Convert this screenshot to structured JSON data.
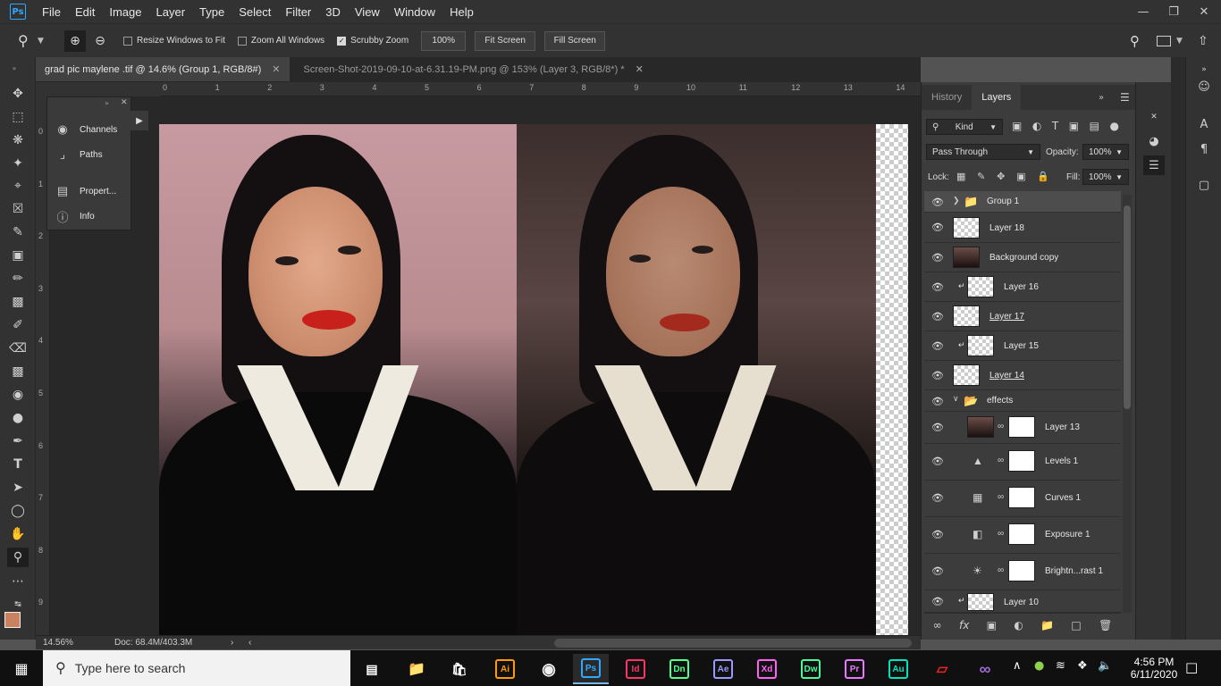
{
  "app": {
    "logo": "Ps",
    "menu": [
      "File",
      "Edit",
      "Image",
      "Layer",
      "Type",
      "Select",
      "Filter",
      "3D",
      "View",
      "Window",
      "Help"
    ],
    "window_controls": [
      "minimize",
      "restore",
      "close"
    ]
  },
  "options_bar": {
    "resize_windows_label": "Resize Windows to Fit",
    "resize_windows_checked": false,
    "zoom_all_label": "Zoom All Windows",
    "zoom_all_checked": false,
    "scrubby_label": "Scrubby Zoom",
    "scrubby_checked": true,
    "zoom_value": "100%",
    "fit_screen": "Fit Screen",
    "fill_screen": "Fill Screen"
  },
  "tabs": [
    {
      "label": "grad pic maylene .tif @ 14.6% (Group 1, RGB/8#)",
      "active": true
    },
    {
      "label": "Screen-Shot-2019-09-10-at-6.31.19-PM.png @ 153% (Layer 3, RGB/8*) *",
      "active": false
    }
  ],
  "ruler_top": [
    "0",
    "1",
    "2",
    "3",
    "4",
    "5",
    "6",
    "7",
    "8",
    "9",
    "10",
    "11",
    "12",
    "13",
    "14"
  ],
  "ruler_left": [
    "0",
    "1",
    "2",
    "3",
    "4",
    "5",
    "6",
    "7",
    "8",
    "9"
  ],
  "float_panel": {
    "items": [
      {
        "label": "Channels",
        "icon": "channels-icon"
      },
      {
        "label": "Paths",
        "icon": "paths-icon"
      },
      {
        "label": "Propert...",
        "icon": "properties-icon"
      },
      {
        "label": "Info",
        "icon": "info-icon"
      }
    ]
  },
  "status": {
    "zoom": "14.56%",
    "doc": "Doc: 68.4M/403.3M"
  },
  "layers_panel": {
    "tabs": [
      "History",
      "Layers"
    ],
    "active_tab": "Layers",
    "filter_kind": "Kind",
    "blend_mode": "Pass Through",
    "opacity_label": "Opacity:",
    "opacity": "100%",
    "lock_label": "Lock:",
    "fill_label": "Fill:",
    "fill": "100%",
    "layers": [
      {
        "name": "Group 1",
        "type": "group",
        "selected": true
      },
      {
        "name": "Layer 18",
        "type": "pixel"
      },
      {
        "name": "Background copy",
        "type": "image"
      },
      {
        "name": "Layer 16",
        "type": "clipped"
      },
      {
        "name": "Layer 17",
        "type": "pixel"
      },
      {
        "name": "Layer 15",
        "type": "clipped"
      },
      {
        "name": "Layer 14",
        "type": "pixel"
      },
      {
        "name": "effects",
        "type": "group-open"
      },
      {
        "name": "Layer 13",
        "type": "masked"
      },
      {
        "name": "Levels 1",
        "type": "adjustment",
        "icon": "levels-icon"
      },
      {
        "name": "Curves 1",
        "type": "adjustment",
        "icon": "curves-icon"
      },
      {
        "name": "Exposure 1",
        "type": "adjustment",
        "icon": "exposure-icon"
      },
      {
        "name": "Brightn...rast 1",
        "type": "adjustment",
        "icon": "brightness-icon"
      },
      {
        "name": "Layer 10",
        "type": "clipped"
      }
    ]
  },
  "taskbar": {
    "search_placeholder": "Type here to search",
    "apps": [
      {
        "label": "Ai",
        "color": "#ff9a00"
      },
      {
        "label": "Ps",
        "color": "#31a8ff"
      },
      {
        "label": "Id",
        "color": "#ff3366"
      },
      {
        "label": "Dn",
        "color": "#51ff8e"
      },
      {
        "label": "Ae",
        "color": "#9999ff"
      },
      {
        "label": "Xd",
        "color": "#ff61f6"
      },
      {
        "label": "Dw",
        "color": "#4afa9a"
      },
      {
        "label": "Pr",
        "color": "#ea77ff"
      },
      {
        "label": "Au",
        "color": "#00e4bb"
      }
    ],
    "time": "4:56 PM",
    "date": "6/11/2020"
  }
}
